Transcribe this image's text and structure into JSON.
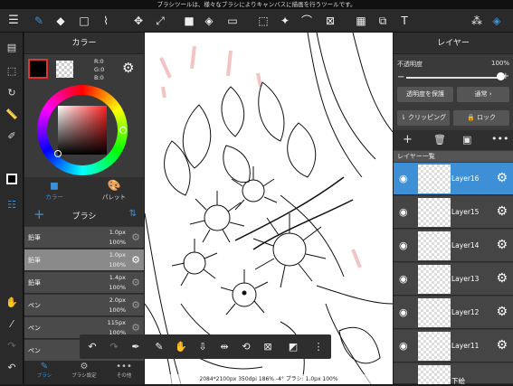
{
  "status_bar": {
    "text": "ブラシツールは、様々なブラシによりキャンバスに描画を行うツールです。"
  },
  "toolbar": {
    "icons": [
      "pen-icon",
      "eraser-icon",
      "rect-icon",
      "move-icon",
      "transform-icon",
      "fill-icon",
      "gradient-icon",
      "select-icon",
      "wand-icon",
      "lasso-icon",
      "pick-icon",
      "frame-icon",
      "filter-icon",
      "text-icon",
      "materials-icon",
      "layers-icon"
    ]
  },
  "color_panel": {
    "title": "カラー",
    "r": "R:0",
    "g": "G:0",
    "b": "B:0",
    "tab_color": "カラー",
    "tab_palette": "パレット",
    "accent": "#3d8fd6"
  },
  "brush_panel": {
    "title": "ブラシ",
    "add": "+",
    "sort": "⇅",
    "items": [
      {
        "name": "鉛筆",
        "size": "1.0px",
        "opacity": "100%"
      },
      {
        "name": "鉛筆",
        "size": "1.0px",
        "opacity": "100%"
      },
      {
        "name": "鉛筆",
        "size": "1.4px",
        "opacity": "100%"
      },
      {
        "name": "ペン",
        "size": "2.0px",
        "opacity": "100%"
      },
      {
        "name": "ペン",
        "size": "115px",
        "opacity": "100%"
      },
      {
        "name": "ペン",
        "size": "",
        "opacity": ""
      }
    ],
    "bottom_tabs": [
      "ブラシ",
      "ブラシ設定",
      "その他"
    ]
  },
  "canvas": {
    "status": "2084*2100px 350dpi 186% -4° ブラシ: 1.0px 100%"
  },
  "layer_panel": {
    "title": "レイヤー",
    "opacity_label": "不透明度",
    "opacity_value": "100%",
    "opacity_level": 1.0,
    "protect_alpha": "透明度を保護",
    "blend_mode": "通常",
    "clipping": "クリッピング",
    "lock": "ロック",
    "list_title": "レイヤー一覧",
    "layers": [
      {
        "name": "Layer16",
        "selected": true
      },
      {
        "name": "Layer15",
        "selected": false
      },
      {
        "name": "Layer14",
        "selected": false
      },
      {
        "name": "Layer13",
        "selected": false
      },
      {
        "name": "Layer12",
        "selected": false
      },
      {
        "name": "Layer11",
        "selected": false
      }
    ],
    "bottom_label": "下絵"
  }
}
